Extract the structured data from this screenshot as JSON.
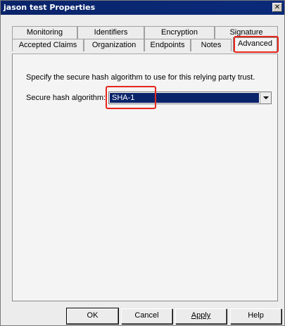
{
  "window": {
    "title": "jason test Properties",
    "close_glyph": "✕"
  },
  "tabs": {
    "row1": [
      "Monitoring",
      "Identifiers",
      "Encryption",
      "Signature"
    ],
    "row2": [
      "Accepted Claims",
      "Organization",
      "Endpoints",
      "Notes",
      "Advanced"
    ],
    "active": "Advanced"
  },
  "panel": {
    "description": "Specify the secure hash algorithm to use for this relying party trust.",
    "field_label": "Secure hash algorithm:",
    "select_value": "SHA-1"
  },
  "buttons": {
    "ok": "OK",
    "cancel": "Cancel",
    "apply": "Apply",
    "help": "Help"
  },
  "colors": {
    "titlebar": "#0a246a",
    "highlight_annotation": "#e8261c",
    "selection": "#0a246a"
  }
}
